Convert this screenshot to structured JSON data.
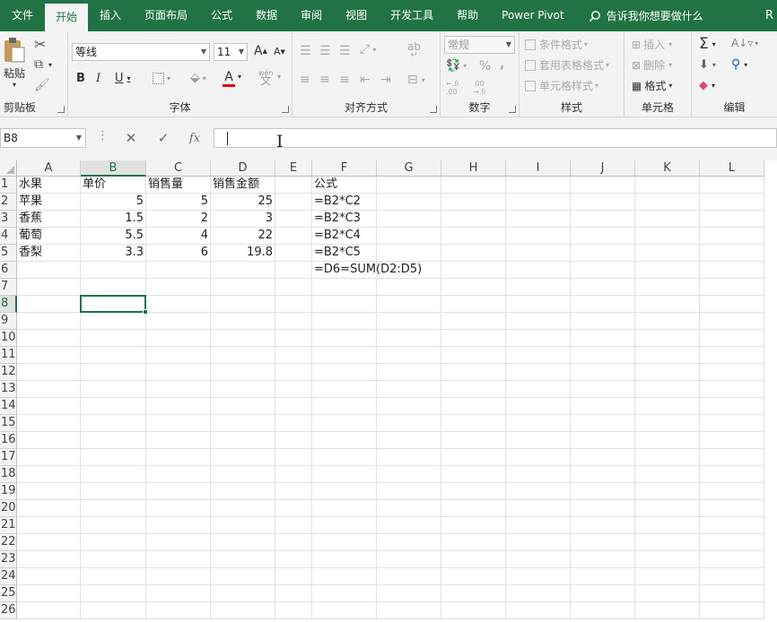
{
  "tabs": [
    {
      "id": "file",
      "label": "文件"
    },
    {
      "id": "home",
      "label": "开始",
      "active": true
    },
    {
      "id": "insert",
      "label": "插入"
    },
    {
      "id": "layout",
      "label": "页面布局"
    },
    {
      "id": "formulas",
      "label": "公式"
    },
    {
      "id": "data",
      "label": "数据"
    },
    {
      "id": "review",
      "label": "审阅"
    },
    {
      "id": "view",
      "label": "视图"
    },
    {
      "id": "developer",
      "label": "开发工具"
    },
    {
      "id": "help",
      "label": "帮助"
    },
    {
      "id": "powerpivot",
      "label": "Power Pivot"
    }
  ],
  "tell_me": "告诉我你想要做什么",
  "account_initial": "R",
  "ribbon": {
    "clipboard": {
      "label": "剪贴板",
      "paste": "粘贴"
    },
    "font": {
      "label": "字体",
      "font_name": "等线",
      "font_size": "11",
      "bold": "B",
      "italic": "I",
      "underline": "U",
      "grow": "A",
      "shrink": "A",
      "phonetic": "wén",
      "phonetic_char": "文",
      "font_color_letter": "A",
      "font_color": "#e00000"
    },
    "alignment": {
      "label": "对齐方式",
      "wrap_char": "ab"
    },
    "number": {
      "label": "数字",
      "format": "常规",
      "percent": "%",
      "comma": ",",
      "inc_decimal": "←.0 .00",
      "dec_decimal": ".00 →.0"
    },
    "styles": {
      "label": "样式",
      "conditional": "条件格式",
      "as_table": "套用表格格式",
      "cell_styles": "单元格样式"
    },
    "cells": {
      "label": "单元格",
      "insert": "插入",
      "delete": "删除",
      "format": "格式"
    },
    "editing": {
      "label": "编辑",
      "sum": "Σ"
    }
  },
  "formula_bar": {
    "name_box": "B8",
    "cancel": "✕",
    "enter": "✓",
    "fx": "fx",
    "value": ""
  },
  "sheet": {
    "columns": [
      "A",
      "B",
      "C",
      "D",
      "E",
      "F",
      "G",
      "H",
      "I",
      "J",
      "K",
      "L"
    ],
    "selected_column": "B",
    "rows": [
      "1",
      "2",
      "3",
      "4",
      "5",
      "6",
      "7",
      "8",
      "9",
      "10",
      "11",
      "12",
      "13",
      "14",
      "15",
      "16",
      "17",
      "18",
      "19",
      "20",
      "21",
      "22",
      "23",
      "24",
      "25",
      "26"
    ],
    "selected_row": "8",
    "cells": [
      {
        "ref": "A1",
        "value": "水果"
      },
      {
        "ref": "B1",
        "value": "单价"
      },
      {
        "ref": "C1",
        "value": "销售量"
      },
      {
        "ref": "D1",
        "value": "销售金额"
      },
      {
        "ref": "F1",
        "value": "公式"
      },
      {
        "ref": "A2",
        "value": "苹果"
      },
      {
        "ref": "B2",
        "value": "5",
        "num": true
      },
      {
        "ref": "C2",
        "value": "5",
        "num": true
      },
      {
        "ref": "D2",
        "value": "25",
        "num": true
      },
      {
        "ref": "F2",
        "value": "=B2*C2"
      },
      {
        "ref": "A3",
        "value": "香蕉"
      },
      {
        "ref": "B3",
        "value": "1.5",
        "num": true
      },
      {
        "ref": "C3",
        "value": "2",
        "num": true
      },
      {
        "ref": "D3",
        "value": "3",
        "num": true
      },
      {
        "ref": "F3",
        "value": "=B2*C3"
      },
      {
        "ref": "A4",
        "value": "葡萄"
      },
      {
        "ref": "B4",
        "value": "5.5",
        "num": true
      },
      {
        "ref": "C4",
        "value": "4",
        "num": true
      },
      {
        "ref": "D4",
        "value": "22",
        "num": true
      },
      {
        "ref": "F4",
        "value": "=B2*C4"
      },
      {
        "ref": "A5",
        "value": "香梨"
      },
      {
        "ref": "B5",
        "value": "3.3",
        "num": true
      },
      {
        "ref": "C5",
        "value": "6",
        "num": true
      },
      {
        "ref": "D5",
        "value": "19.8",
        "num": true
      },
      {
        "ref": "F5",
        "value": "=B2*C5"
      },
      {
        "ref": "F6",
        "value": "=D6=SUM(D2:D5)"
      }
    ],
    "active_cell": "B8"
  },
  "colors": {
    "accent": "#217346",
    "ribbon_bg": "#f3f3f3",
    "grid_line": "#e0e0e0"
  }
}
